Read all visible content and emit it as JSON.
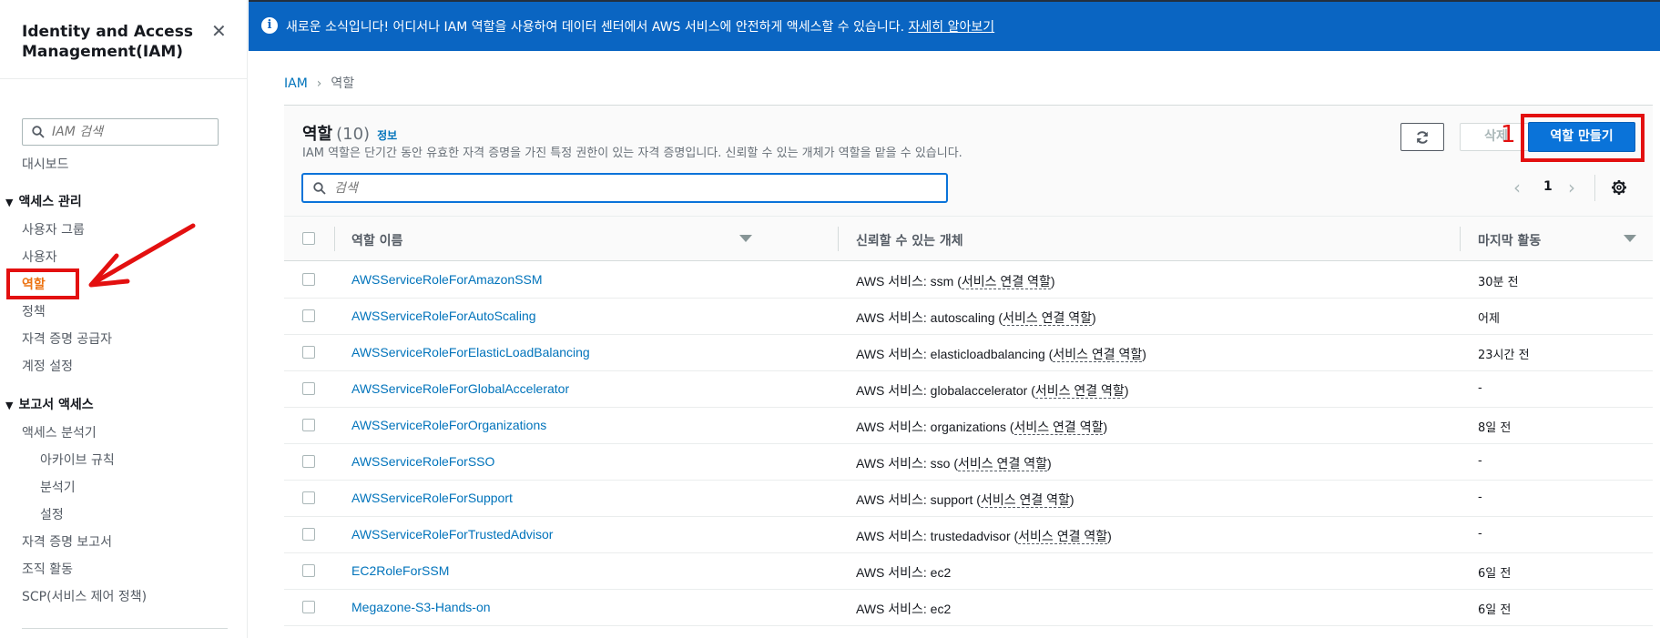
{
  "sidebar": {
    "title": "Identity and Access Management(IAM)",
    "search_placeholder": "IAM 검색",
    "dashboard": "대시보드",
    "section_access": "액세스 관리",
    "user_groups": "사용자 그룹",
    "users": "사용자",
    "roles": "역할",
    "policies": "정책",
    "identity_providers": "자격 증명 공급자",
    "account_settings": "계정 설정",
    "section_reports": "보고서 액세스",
    "access_analyzer": "액세스 분석기",
    "archive_rules": "아카이브 규칙",
    "analyzers": "분석기",
    "settings": "설정",
    "credential_report": "자격 증명 보고서",
    "org_activity": "조직 활동",
    "scp": "SCP(서비스 제어 정책)"
  },
  "banner": {
    "message": "새로운 소식입니다! 어디서나 IAM 역할을 사용하여 데이터 센터에서 AWS 서비스에 안전하게 액세스할 수 있습니다.",
    "link": "자세히 알아보기"
  },
  "breadcrumb": {
    "root": "IAM",
    "current": "역할"
  },
  "header": {
    "title": "역할",
    "count": "(10)",
    "info": "정보",
    "description": "IAM 역할은 단기간 동안 유효한 자격 증명을 가진 특정 권한이 있는 자격 증명입니다. 신뢰할 수 있는 개체가 역할을 맡을 수 있습니다.",
    "delete_label": "삭제",
    "create_label": "역할 만들기",
    "annotation": "1"
  },
  "search": {
    "placeholder": "검색"
  },
  "pagination": {
    "current_page": "1"
  },
  "table": {
    "columns": {
      "name": "역할 이름",
      "trusted": "신뢰할 수 있는 개체",
      "last_activity": "마지막 활동"
    },
    "rows": [
      {
        "name": "AWSServiceRoleForAmazonSSM",
        "trust_prefix": "AWS 서비스: ssm (",
        "trust_link": "서비스 연결 역할",
        "trust_suffix": ")",
        "activity": "30분 전"
      },
      {
        "name": "AWSServiceRoleForAutoScaling",
        "trust_prefix": "AWS 서비스: autoscaling (",
        "trust_link": "서비스 연결 역할",
        "trust_suffix": ")",
        "activity": "어제"
      },
      {
        "name": "AWSServiceRoleForElasticLoadBalancing",
        "trust_prefix": "AWS 서비스: elasticloadbalancing (",
        "trust_link": "서비스 연결 역할",
        "trust_suffix": ")",
        "activity": "23시간 전"
      },
      {
        "name": "AWSServiceRoleForGlobalAccelerator",
        "trust_prefix": "AWS 서비스: globalaccelerator (",
        "trust_link": "서비스 연결 역할",
        "trust_suffix": ")",
        "activity": "-"
      },
      {
        "name": "AWSServiceRoleForOrganizations",
        "trust_prefix": "AWS 서비스: organizations (",
        "trust_link": "서비스 연결 역할",
        "trust_suffix": ")",
        "activity": "8일 전"
      },
      {
        "name": "AWSServiceRoleForSSO",
        "trust_prefix": "AWS 서비스: sso (",
        "trust_link": "서비스 연결 역할",
        "trust_suffix": ")",
        "activity": "-"
      },
      {
        "name": "AWSServiceRoleForSupport",
        "trust_prefix": "AWS 서비스: support (",
        "trust_link": "서비스 연결 역할",
        "trust_suffix": ")",
        "activity": "-"
      },
      {
        "name": "AWSServiceRoleForTrustedAdvisor",
        "trust_prefix": "AWS 서비스: trustedadvisor (",
        "trust_link": "서비스 연결 역할",
        "trust_suffix": ")",
        "activity": "-"
      },
      {
        "name": "EC2RoleForSSM",
        "trust_prefix": "AWS 서비스: ec2",
        "trust_link": "",
        "trust_suffix": "",
        "activity": "6일 전"
      },
      {
        "name": "Megazone-S3-Hands-on",
        "trust_prefix": "AWS 서비스: ec2",
        "trust_link": "",
        "trust_suffix": "",
        "activity": "6일 전"
      }
    ]
  },
  "colors": {
    "banner_bg": "#0a65c2",
    "primary_button": "#0a73d9",
    "link": "#0073bb",
    "active_nav": "#ec7211",
    "annotation_red": "#e31010"
  },
  "icons": {
    "banner": "info-icon",
    "sidebar_close": "close-icon",
    "search": "search-icon",
    "refresh": "refresh-icon",
    "settings": "gear-icon",
    "prev": "chevron-left-icon",
    "next": "chevron-right-icon"
  }
}
